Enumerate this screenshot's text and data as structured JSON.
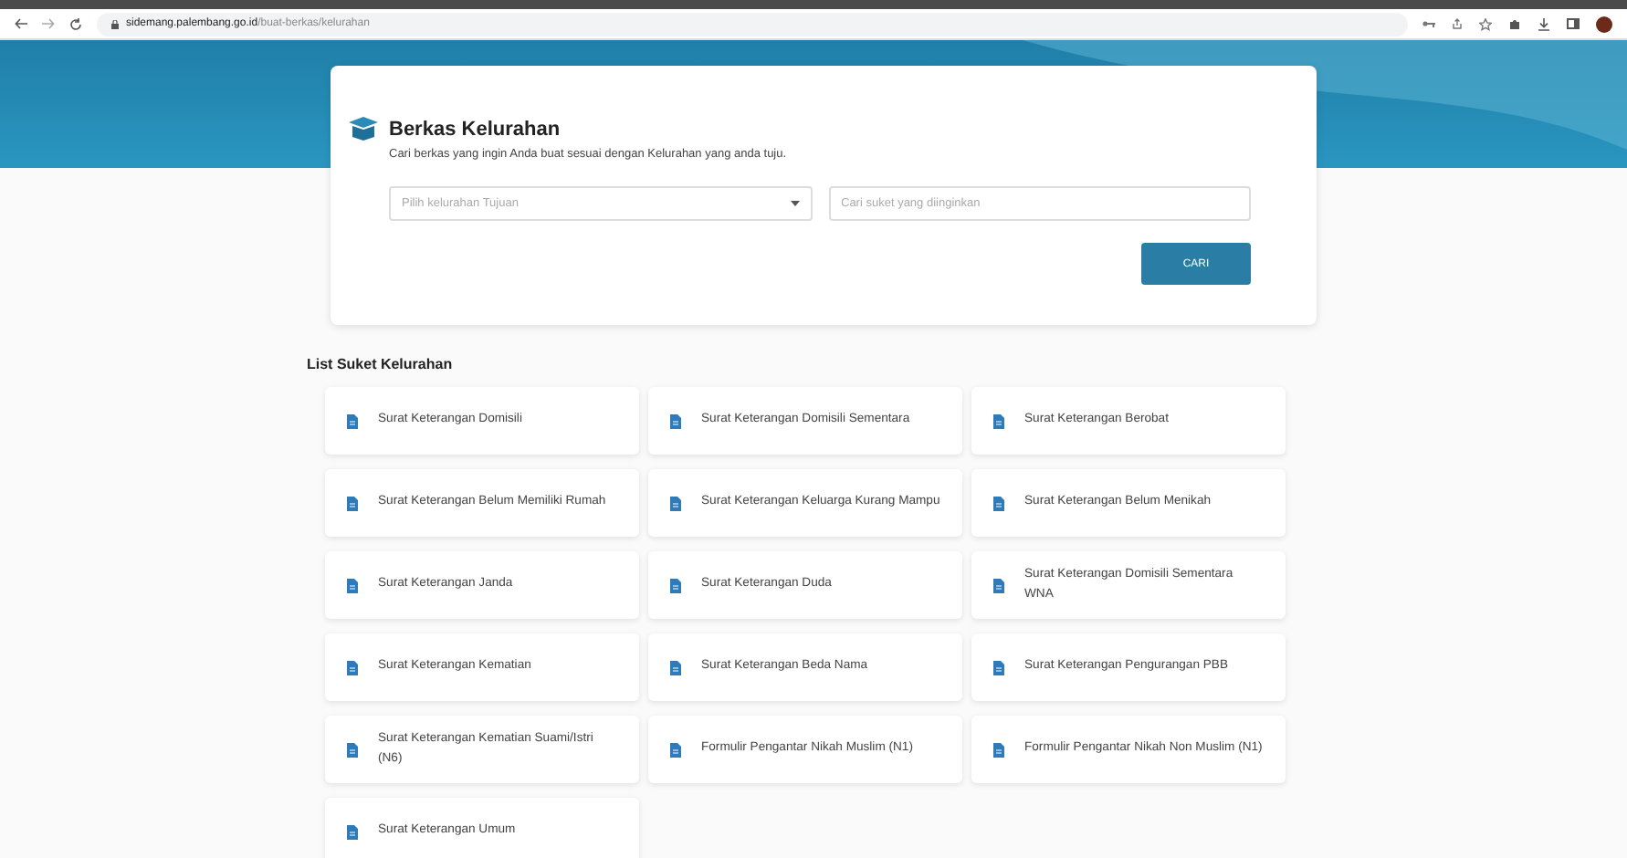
{
  "browser": {
    "url_host": "sidemang.palembang.go.id",
    "url_path": "/buat-berkas/kelurahan"
  },
  "search_card": {
    "title": "Berkas Kelurahan",
    "subtitle": "Cari berkas yang ingin Anda buat sesuai dengan Kelurahan yang anda tuju.",
    "select_placeholder": "Pilih kelurahan Tujuan",
    "search_placeholder": "Cari suket yang diinginkan",
    "button": "CARI"
  },
  "list_title": "List Suket Kelurahan",
  "items": [
    {
      "label": "Surat Keterangan Domisili"
    },
    {
      "label": "Surat Keterangan Domisili Sementara"
    },
    {
      "label": "Surat Keterangan Berobat"
    },
    {
      "label": "Surat Keterangan Belum Memiliki Rumah"
    },
    {
      "label": "Surat Keterangan Keluarga Kurang Mampu"
    },
    {
      "label": "Surat Keterangan Belum Menikah"
    },
    {
      "label": "Surat Keterangan Janda"
    },
    {
      "label": "Surat Keterangan Duda"
    },
    {
      "label": "Surat Keterangan Domisili Sementara WNA"
    },
    {
      "label": "Surat Keterangan Kematian"
    },
    {
      "label": "Surat Keterangan Beda Nama"
    },
    {
      "label": "Surat Keterangan Pengurangan PBB"
    },
    {
      "label": "Surat Keterangan Kematian Suami/Istri (N6)"
    },
    {
      "label": "Formulir Pengantar Nikah Muslim (N1)"
    },
    {
      "label": "Formulir Pengantar Nikah Non Muslim (N1)"
    },
    {
      "label": "Surat Keterangan Umum"
    }
  ]
}
